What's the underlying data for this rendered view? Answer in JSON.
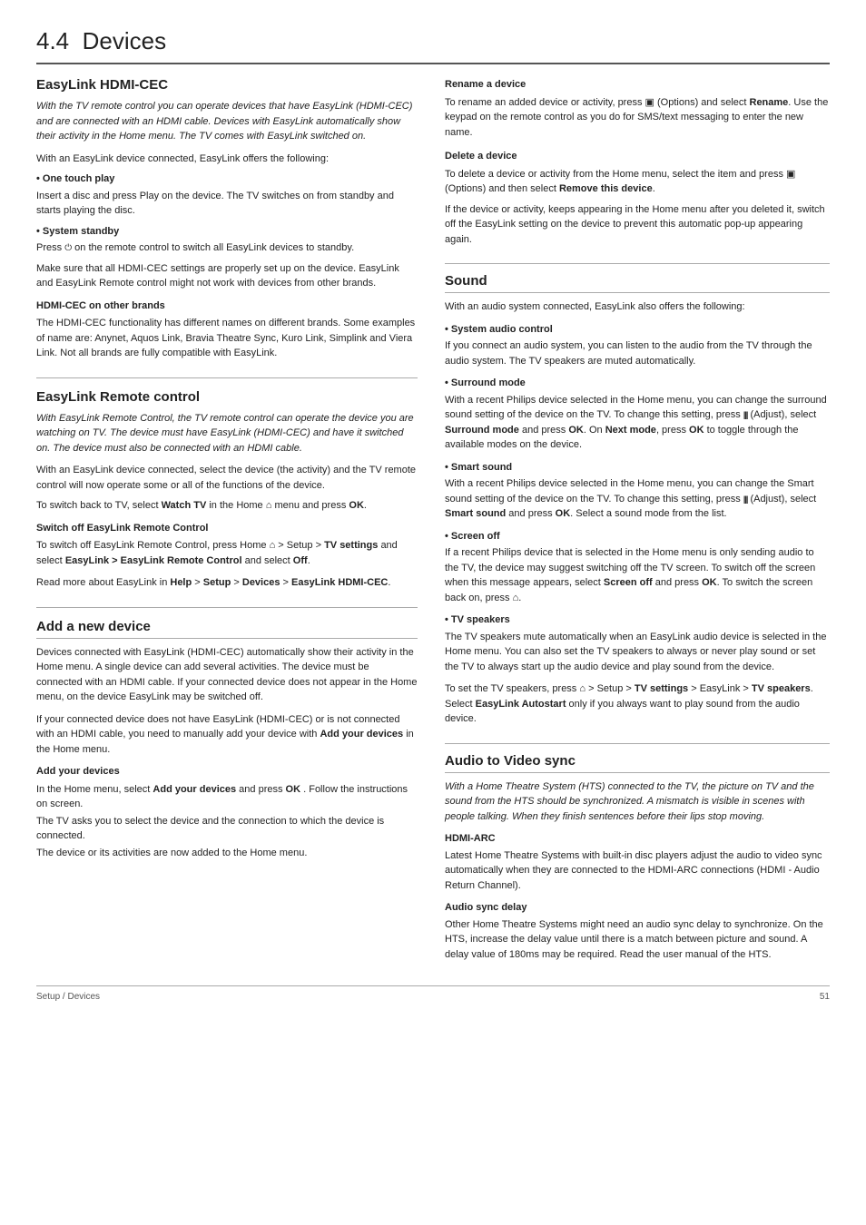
{
  "page": {
    "title_number": "4.4",
    "title": "Devices",
    "footer_left": "Setup / Devices",
    "footer_right": "51"
  },
  "left": {
    "section1": {
      "title": "EasyLink HDMI-CEC",
      "intro": "With the TV remote control you can operate devices that have EasyLink (HDMI-CEC) and are connected with an HDMI cable. Devices with EasyLink automatically show their activity in the Home menu. The TV comes with EasyLink switched on.",
      "para1": "With an EasyLink device connected, EasyLink offers the following:",
      "bullet1_title": "• One touch play",
      "bullet1_text": "Insert a disc and press Play on the device. The TV switches on from standby and starts playing the disc.",
      "bullet2_title": "• System standby",
      "bullet2_text1": "Press",
      "bullet2_text2": "on the remote control to switch all EasyLink devices to standby.",
      "para2": "Make sure that all HDMI-CEC settings are properly set up on the device. EasyLink and EasyLink Remote control might not work with devices from other brands.",
      "sub1_title": "HDMI-CEC on other brands",
      "sub1_text": "The HDMI-CEC functionality has different names on different brands. Some examples of name are: Anynet, Aquos Link, Bravia Theatre Sync, Kuro Link, Simplink and Viera Link. Not all brands are fully compatible with EasyLink."
    },
    "section2": {
      "title": "EasyLink Remote control",
      "intro": "With EasyLink Remote Control, the TV remote control can operate the device you are watching on TV. The device must have EasyLink (HDMI-CEC) and have it switched on. The device must also be connected with an HDMI cable.",
      "para1": "With an EasyLink device connected, select the device (the activity) and the TV remote control will now operate some or all of the functions of the device.",
      "para2_pre": "To switch back to TV, select",
      "para2_bold": "Watch TV",
      "para2_mid": "in the Home",
      "para2_post": "menu and press",
      "para2_ok": "OK",
      "para2_end": ".",
      "sub1_title": "Switch off EasyLink Remote Control",
      "sub1_text1": "To switch off EasyLink Remote Control, press Home",
      "sub1_text2": "> Setup >",
      "sub1_text3": "TV settings",
      "sub1_text4": "and select",
      "sub1_text5": "EasyLink > EasyLink Remote Control",
      "sub1_text6": "and select",
      "sub1_text7": "Off",
      "sub1_text8": ".",
      "para3_pre": "Read more about EasyLink in",
      "para3_bold1": "Help",
      "para3_sym1": ">",
      "para3_bold2": "Setup",
      "para3_sym2": ">",
      "para3_bold3": "Devices",
      "para3_sym3": ">",
      "para3_bold4": "EasyLink HDMI-CEC",
      "para3_end": "."
    },
    "section3": {
      "title": "Add a new device",
      "para1": "Devices connected with EasyLink (HDMI-CEC) automatically show their activity in the Home menu. A single device can add several activities. The device must be connected with an HDMI cable. If your connected device does not appear in the Home menu, on the device EasyLink may be switched off.",
      "para2_pre": "If your connected device does not have EasyLink (HDMI-CEC) or is not connected with an HDMI cable, you need to manually add your device with",
      "para2_bold": "Add your devices",
      "para2_post": "in the Home menu.",
      "sub1_title": "Add your devices",
      "sub1_text1": "In the Home menu, select",
      "sub1_bold1": "Add your devices",
      "sub1_text2": "and press",
      "sub1_bold2": "OK",
      "sub1_text3": ". Follow the instructions on screen.",
      "sub1_line2": "The TV asks you to select the device and the connection to which the device is connected.",
      "sub1_line3": "The device or its activities are now added to the Home menu."
    }
  },
  "right": {
    "section_rename": {
      "title": "Rename a device",
      "text1": "To rename an added device or activity, press",
      "options_sym": "▣",
      "text2": "(Options) and select",
      "bold1": "Rename",
      "text3": ". Use the keypad on the remote control as you do for SMS/text messaging to enter the new name."
    },
    "section_delete": {
      "title": "Delete a device",
      "text1": "To delete a device or activity from the Home menu, select the item and press",
      "options_sym": "▣",
      "text2": "(Options) and then select",
      "bold1": "Remove this device",
      "text3": ".",
      "para2": "If the device or activity, keeps appearing in the Home menu after you deleted it, switch off the EasyLink setting on the device to prevent this automatic pop-up appearing again."
    },
    "section_sound": {
      "title": "Sound",
      "intro": "With an audio system connected, EasyLink also offers the following:",
      "bullet1_title": "• System audio control",
      "bullet1_text": "If you connect an audio system, you can listen to the audio from the TV through the audio system. The TV speakers are muted automatically.",
      "bullet2_title": "• Surround mode",
      "bullet2_text1": "With a recent Philips device selected in the Home menu, you can change the surround sound setting of the device on the TV. To change this setting, press",
      "bullet2_adjust": "|||",
      "bullet2_text2": "(Adjust), select",
      "bullet2_bold1": "Surround mode",
      "bullet2_text3": "and press",
      "bullet2_bold2": "OK",
      "bullet2_text4": ". On",
      "bullet2_bold3": "Next mode",
      "bullet2_text5": ", press",
      "bullet2_bold4": "OK",
      "bullet2_text6": "to toggle through the available modes on the device.",
      "bullet3_title": "• Smart sound",
      "bullet3_text1": "With a recent Philips device selected in the Home menu, you can change the Smart sound setting of the device on the TV. To change this setting, press",
      "bullet3_adjust": "|||",
      "bullet3_text2": "(Adjust), select",
      "bullet3_bold1": "Smart sound",
      "bullet3_text3": "and press",
      "bullet3_bold2": "OK",
      "bullet3_text4": ". Select a sound mode from the list.",
      "bullet4_title": "• Screen off",
      "bullet4_text1": "If a recent Philips device that is selected in the Home menu is only sending audio to the TV, the device may suggest switching off the TV screen. To switch off the screen when this message appears, select",
      "bullet4_bold1": "Screen off",
      "bullet4_text2": "and press",
      "bullet4_bold2": "OK",
      "bullet4_text3": ". To switch the screen back on, press",
      "bullet4_home": "⌂",
      "bullet4_text4": ".",
      "bullet5_title": "• TV speakers",
      "bullet5_text": "The TV speakers mute automatically when an EasyLink audio device is selected in the Home menu. You can also set the TV speakers to always or never play sound or set the TV to always start up the audio device and play sound from the device.",
      "para_tvspeakers1": "To set the TV speakers, press",
      "para_tvspeakers_home": "⌂",
      "para_tvspeakers2": "> Setup >",
      "para_tvspeakers3": "TV settings",
      "para_tvspeakers4": "> EasyLink >",
      "para_tvspeakers5": "TV speakers",
      "para_tvspeakers6": ". Select",
      "para_tvspeakers7": "EasyLink Autostart",
      "para_tvspeakers8": "only if you always want to play sound from the audio device."
    },
    "section_avs": {
      "title": "Audio to Video sync",
      "intro": "With a Home Theatre System (HTS) connected to the TV, the picture on TV and the sound from the HTS should be synchronized. A mismatch is visible in scenes with people talking. When they finish sentences before their lips stop moving.",
      "sub1_title": "HDMI-ARC",
      "sub1_text": "Latest Home Theatre Systems with built-in disc players adjust the audio to video sync automatically when they are connected to the HDMI-ARC connections (HDMI - Audio Return Channel).",
      "sub2_title": "Audio sync delay",
      "sub2_text": "Other Home Theatre Systems might need an audio sync delay to synchronize. On the HTS, increase the delay value until there is a match between picture and sound. A delay value of 180ms may be required. Read the user manual of the HTS."
    }
  }
}
